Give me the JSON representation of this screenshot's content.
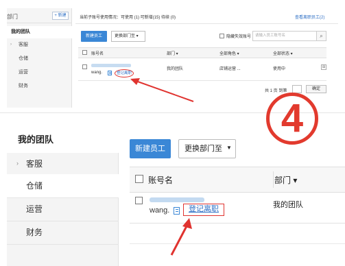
{
  "top": {
    "sidebar": {
      "title": "部门",
      "new_button": "+ 新建",
      "items": [
        {
          "label": "我的团队"
        },
        {
          "label": "客服"
        },
        {
          "label": "仓储"
        },
        {
          "label": "运营"
        },
        {
          "label": "财务"
        }
      ]
    },
    "info_text": "当前子账号使用情况：可使用 (1)   可新增(15)   待续 (0)",
    "view_resigned_link": "查看离职员工(2)",
    "toolbar": {
      "new_staff": "新建员工",
      "change_dept": "更换部门至  ▾",
      "hide_deactivated": "隐藏失效账号",
      "search_placeholder": "请输入员工账号名"
    },
    "table": {
      "headers": {
        "account": "账号名",
        "dept": "部门 ▾",
        "role": "全部角色 ▾",
        "status": "全部状态 ▾"
      },
      "row": {
        "account": "wang.",
        "leave_link": "登记离职",
        "dept": "我的团队",
        "role": "店铺运营 ...",
        "status": "使用中"
      }
    },
    "pager": {
      "text": "共 1 页 到第",
      "ok": "确定"
    }
  },
  "step": {
    "number": "4"
  },
  "bottom": {
    "sidebar": {
      "items": [
        {
          "label": "我的团队"
        },
        {
          "label": "客服"
        },
        {
          "label": "仓储"
        },
        {
          "label": "运营"
        },
        {
          "label": "财务"
        }
      ]
    },
    "toolbar": {
      "new_staff": "新建员工",
      "change_dept": "更换部门至"
    },
    "table": {
      "headers": {
        "account": "账号名",
        "dept": "部门 ▾"
      },
      "row": {
        "account": "wang.",
        "leave_link": "登记离职",
        "dept": "我的团队"
      }
    }
  },
  "colors": {
    "accent": "#3a87d6",
    "annotation_red": "#e0332f",
    "link": "#2e6fc5"
  }
}
